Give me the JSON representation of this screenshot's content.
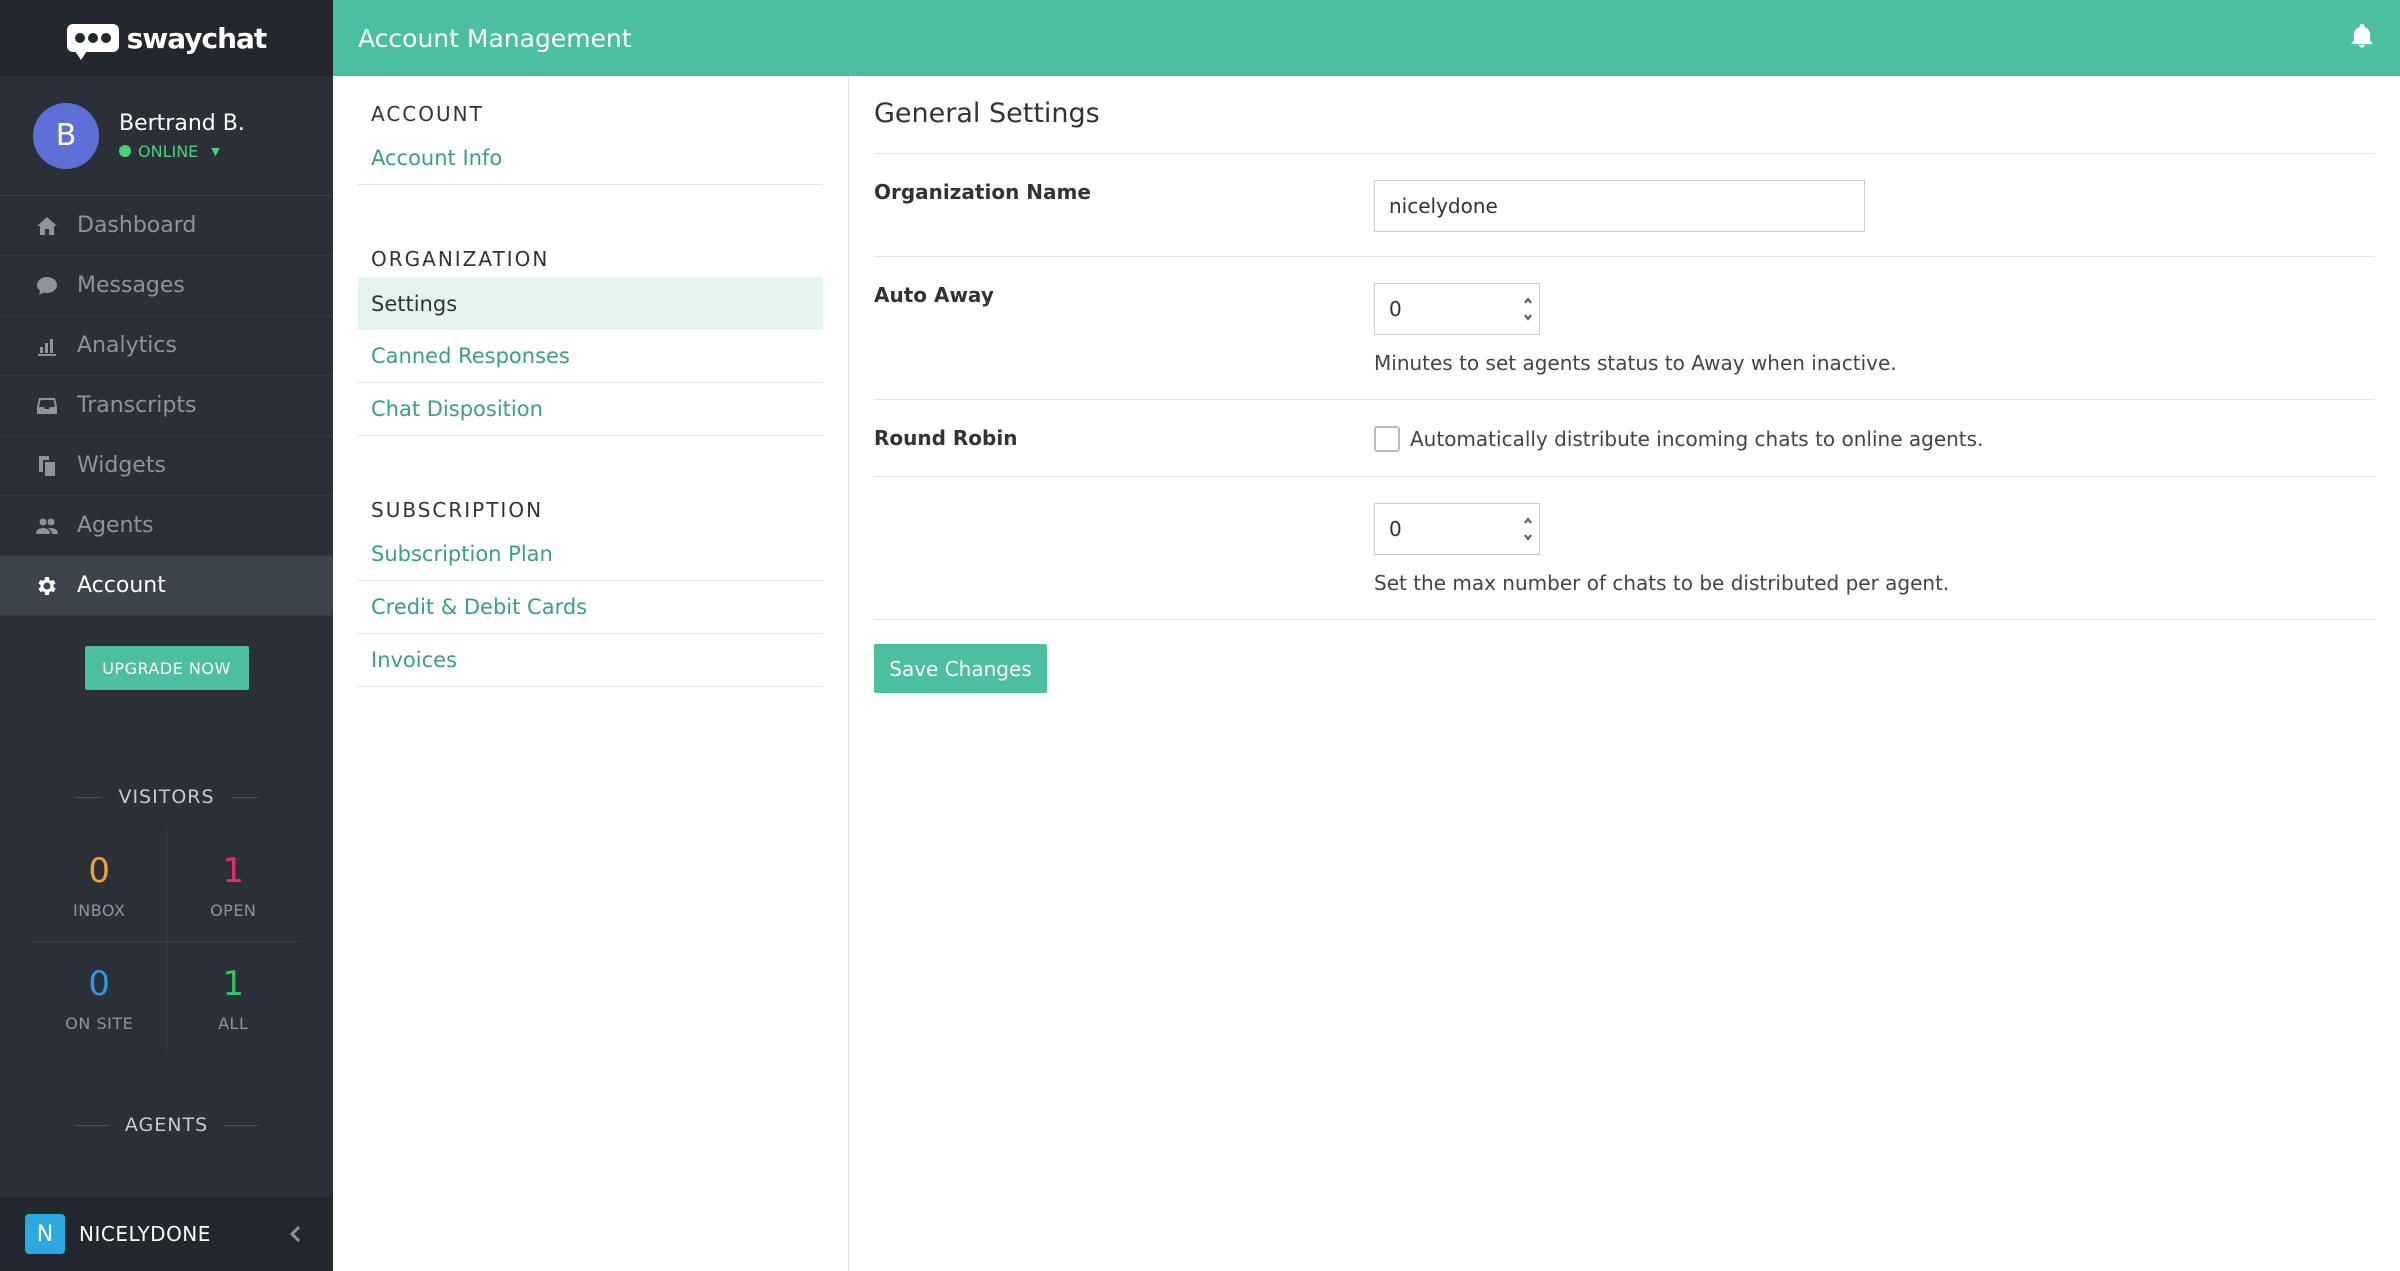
{
  "brand": {
    "name": "swaychat"
  },
  "user": {
    "initial": "B",
    "name": "Bertrand B.",
    "status": "ONLINE"
  },
  "nav": [
    {
      "label": "Dashboard",
      "icon": "home-icon",
      "active": false
    },
    {
      "label": "Messages",
      "icon": "chat-icon",
      "active": false
    },
    {
      "label": "Analytics",
      "icon": "bar-chart-icon",
      "active": false
    },
    {
      "label": "Transcripts",
      "icon": "inbox-icon",
      "active": false
    },
    {
      "label": "Widgets",
      "icon": "copy-icon",
      "active": false
    },
    {
      "label": "Agents",
      "icon": "users-icon",
      "active": false
    },
    {
      "label": "Account",
      "icon": "gear-icon",
      "active": true
    }
  ],
  "upgrade_label": "UPGRADE NOW",
  "visitors": {
    "heading": "VISITORS",
    "stats": [
      {
        "value": "0",
        "label": "INBOX",
        "color": "#f0a030"
      },
      {
        "value": "1",
        "label": "OPEN",
        "color": "#e0306a"
      },
      {
        "value": "0",
        "label": "ON SITE",
        "color": "#2a9ae0"
      },
      {
        "value": "1",
        "label": "ALL",
        "color": "#3cc060"
      }
    ]
  },
  "agents_heading": "AGENTS",
  "org": {
    "initial": "N",
    "name": "NICELYDONE"
  },
  "topbar": {
    "title": "Account Management"
  },
  "submenu": {
    "account_heading": "ACCOUNT",
    "account_items": [
      "Account Info"
    ],
    "organization_heading": "ORGANIZATION",
    "organization_items": [
      "Settings",
      "Canned Responses",
      "Chat Disposition"
    ],
    "subscription_heading": "SUBSCRIPTION",
    "subscription_items": [
      "Subscription Plan",
      "Credit & Debit Cards",
      "Invoices"
    ]
  },
  "main": {
    "title": "General Settings",
    "org_name_label": "Organization Name",
    "org_name_value": "nicelydone",
    "auto_away_label": "Auto Away",
    "auto_away_value": "0",
    "auto_away_help": "Minutes to set agents status to Away when inactive.",
    "round_robin_label": "Round Robin",
    "round_robin_checkbox": "Automatically distribute incoming chats to online agents.",
    "max_chats_value": "0",
    "max_chats_help": "Set the max number of chats to be distributed per agent.",
    "save_label": "Save Changes"
  }
}
